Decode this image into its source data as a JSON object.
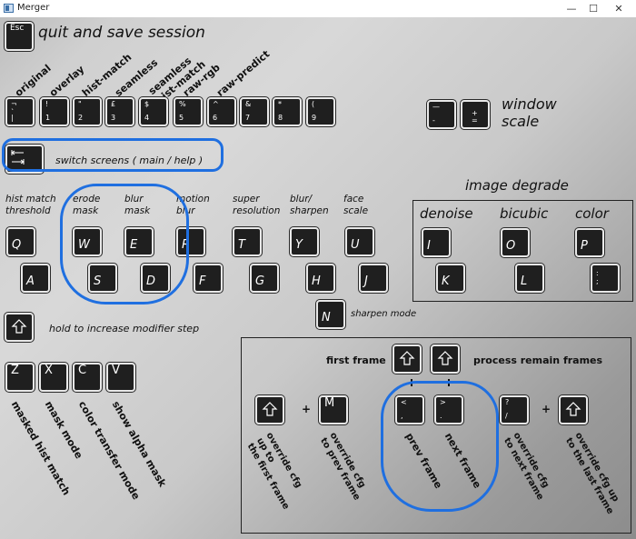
{
  "window": {
    "title": "Merger",
    "minimize": "—",
    "maximize": "☐",
    "close": "✕"
  },
  "esc": {
    "key": "Esc",
    "label": "quit and save session"
  },
  "num_modes": [
    {
      "label": "original",
      "top": "¬\n`",
      "bottom": "|"
    },
    {
      "label": "overlay",
      "top": "!",
      "bottom": "1"
    },
    {
      "label": "hist-match",
      "top": "\"",
      "bottom": "2"
    },
    {
      "label": "seamless",
      "top": "£",
      "bottom": "3"
    },
    {
      "label": "seamless\nhist-match",
      "top": "$",
      "bottom": "4"
    },
    {
      "label": "raw-rgb",
      "top": "%",
      "bottom": "5"
    },
    {
      "label": "raw-predict",
      "top": "^",
      "bottom": "6"
    },
    {
      "label": "",
      "top": "&",
      "bottom": "7"
    },
    {
      "label": "",
      "top": "*",
      "bottom": "8"
    },
    {
      "label": "",
      "top": "(",
      "bottom": "9"
    }
  ],
  "window_scale": {
    "label": "window\nscale",
    "minus_top": "—",
    "minus_bottom": "-",
    "plus_top": "+",
    "plus_bottom": "="
  },
  "tab": {
    "key_icon": "tab-icon",
    "label": "switch screens ( main / help )"
  },
  "image_degrade": {
    "title": "image degrade",
    "denoise": "denoise",
    "bicubic": "bicubic",
    "color": "color",
    "keys": [
      "I",
      "K",
      "O",
      "L",
      "P",
      ":\n;"
    ]
  },
  "cols": [
    {
      "label": "hist match\nthreshold",
      "top": "Q",
      "bottom": "A"
    },
    {
      "label": "erode\nmask",
      "top": "W",
      "bottom": "S"
    },
    {
      "label": "blur\nmask",
      "top": "E",
      "bottom": "D"
    },
    {
      "label": "motion\nblur",
      "top": "R",
      "bottom": "F"
    },
    {
      "label": "super\nresolution",
      "top": "T",
      "bottom": "G"
    },
    {
      "label": "blur/\nsharpen",
      "top": "Y",
      "bottom": "H"
    },
    {
      "label": "face\nscale",
      "top": "U",
      "bottom": "J"
    }
  ],
  "sharpen": {
    "key": "N",
    "label": "sharpen mode"
  },
  "shift": {
    "label": "hold to increase modifier step"
  },
  "bottom_keys": [
    {
      "key": "Z",
      "label": "masked hist match"
    },
    {
      "key": "X",
      "label": "mask mode"
    },
    {
      "key": "C",
      "label": "color transfer mode"
    },
    {
      "key": "V",
      "label": "show alpha mask"
    }
  ],
  "frames": {
    "first_frame": "first frame",
    "process_remain": "process remain frames",
    "plus": "+",
    "override_first": "override cfg\nup to\nthe first frame",
    "override_prev": "override cfg\nto prev frame",
    "prev_frame": "prev frame",
    "next_frame": "next frame",
    "override_next": "override cfg\nto next frame",
    "override_last": "override cfg up\nto the last frame",
    "m_key": "M",
    "prev_key_top": "<",
    "prev_key_bottom": ",",
    "next_key_top": ">",
    "next_key_bottom": ".",
    "slash_top": "?",
    "slash_bottom": "/"
  },
  "colors": {
    "key_bg": "#1f1f1f",
    "annotation_blue": "#1f6fe0"
  }
}
